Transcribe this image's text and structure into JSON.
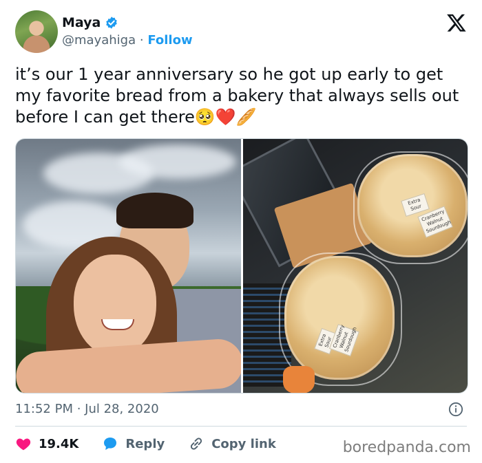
{
  "author": {
    "name": "Maya",
    "handle": "@mayahiga",
    "separator": "·",
    "follow_label": "Follow",
    "verified": true,
    "avatar_icon": "profile-photo"
  },
  "tweet": {
    "text": "it’s our 1 year anniversary so he got up early to get my favorite bread from a bakery that always sells out before I can get there🥺❤️🥖",
    "timestamp": "11:52 PM · Jul 28, 2020"
  },
  "media": {
    "count": 2,
    "images": [
      "selfie-photo",
      "bread-photo"
    ],
    "labels": {
      "label_1": "Extra Sour",
      "label_2": "Cranberry Walnut Sourdough",
      "label_3": "Extra Sour",
      "label_4": "Cranberry Walnut Sourdough"
    }
  },
  "actions": {
    "like_count": "19.4K",
    "reply_label": "Reply",
    "copy_label": "Copy link"
  },
  "watermark": "boredpanda.com",
  "colors": {
    "accent": "#1d9bf0",
    "like": "#f91880",
    "text": "#0f1419",
    "muted": "#536471"
  }
}
